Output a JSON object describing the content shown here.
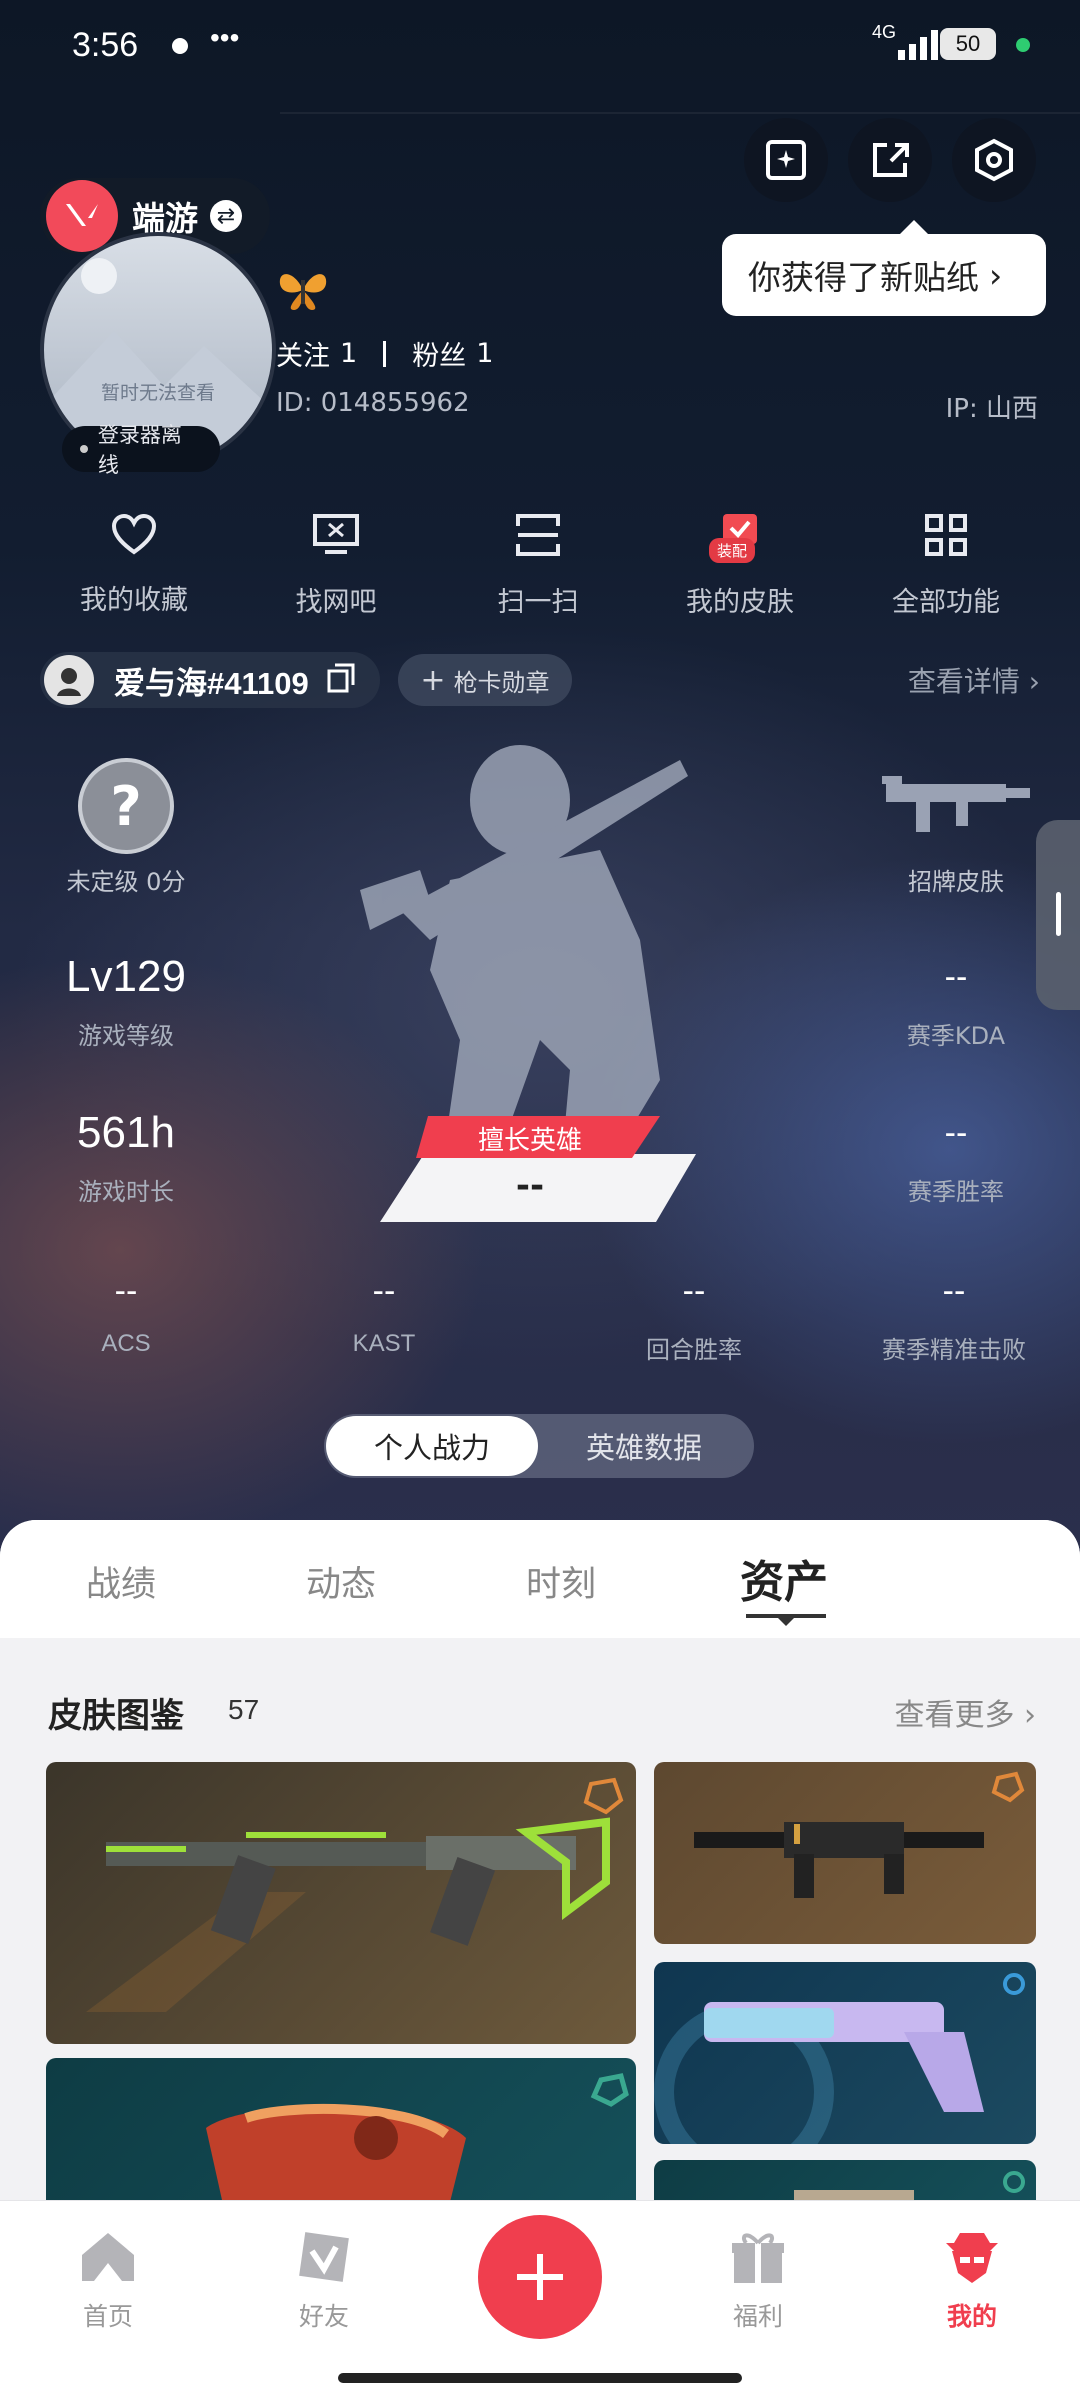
{
  "status_bar": {
    "time": "3:56",
    "dots": "•••",
    "network": "4G",
    "battery": "50"
  },
  "tooltip": "你获得了新贴纸",
  "game_switch": {
    "label": "端游"
  },
  "avatar": {
    "placeholder_text": "暂时无法查看",
    "status": "登录器离线"
  },
  "profile": {
    "follow_label": "关注",
    "follow_count": "1",
    "fans_label": "粉丝",
    "fans_count": "1",
    "id": "ID: 014855962",
    "ip": "IP: 山西"
  },
  "quick_actions": [
    {
      "label": "我的收藏",
      "icon": "heart-icon"
    },
    {
      "label": "找网吧",
      "icon": "monitor-icon"
    },
    {
      "label": "扫一扫",
      "icon": "scan-icon"
    },
    {
      "label": "我的皮肤",
      "icon": "skin-icon",
      "badge": "装配"
    },
    {
      "label": "全部功能",
      "icon": "grid-icon"
    }
  ],
  "player": {
    "name": "爱与海#41109",
    "card_badge": "枪卡勋章",
    "details_link": "查看详情"
  },
  "stats": {
    "rank": {
      "label": "未定级 0分"
    },
    "skin": {
      "label": "招牌皮肤"
    },
    "level": {
      "value": "Lv129",
      "label": "游戏等级"
    },
    "kda": {
      "value": "--",
      "label": "赛季KDA"
    },
    "playtime": {
      "value": "561h",
      "label": "游戏时长"
    },
    "winrate": {
      "value": "--",
      "label": "赛季胜率"
    },
    "hero": {
      "tag": "擅长英雄",
      "value": "--"
    },
    "bottom": [
      {
        "value": "--",
        "label": "ACS"
      },
      {
        "value": "--",
        "label": "KAST"
      },
      {
        "value": "--",
        "label": "回合胜率"
      },
      {
        "value": "--",
        "label": "赛季精准击败"
      }
    ]
  },
  "segment": {
    "active": "个人战力",
    "inactive": "英雄数据"
  },
  "tabs": [
    "战绩",
    "动态",
    "时刻",
    "资产"
  ],
  "section": {
    "title": "皮肤图鉴",
    "count": "57",
    "more": "查看更多"
  },
  "colors": {
    "accent": "#f03e4e",
    "card_brown": "#6e5a3c",
    "card_teal": "#1c4a60"
  },
  "nav": [
    {
      "label": "首页",
      "icon": "home-icon"
    },
    {
      "label": "好友",
      "icon": "friends-icon"
    },
    {
      "label": "",
      "icon": "plus-icon"
    },
    {
      "label": "福利",
      "icon": "gift-icon"
    },
    {
      "label": "我的",
      "icon": "profile-icon"
    }
  ]
}
